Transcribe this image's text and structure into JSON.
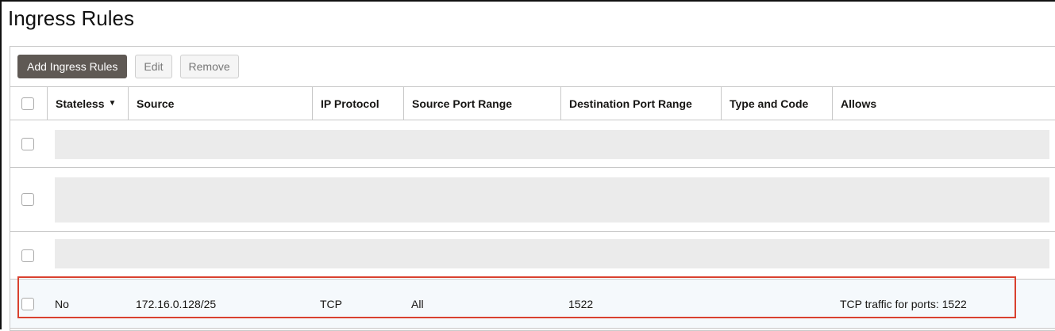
{
  "title": "Ingress Rules",
  "toolbar": {
    "add": "Add Ingress Rules",
    "edit": "Edit",
    "remove": "Remove"
  },
  "columns": [
    "Stateless",
    "Source",
    "IP Protocol",
    "Source Port Range",
    "Destination Port Range",
    "Type and Code",
    "Allows"
  ],
  "sort_icon": "▼",
  "rule": {
    "stateless": "No",
    "source": "172.16.0.128/25",
    "protocol": "TCP",
    "source_port": "All",
    "dest_port": "1522",
    "type_code": "",
    "allows": "TCP traffic for ports: 1522"
  },
  "colors": {
    "highlight": "#d9412f",
    "primary": "#5f5954"
  }
}
